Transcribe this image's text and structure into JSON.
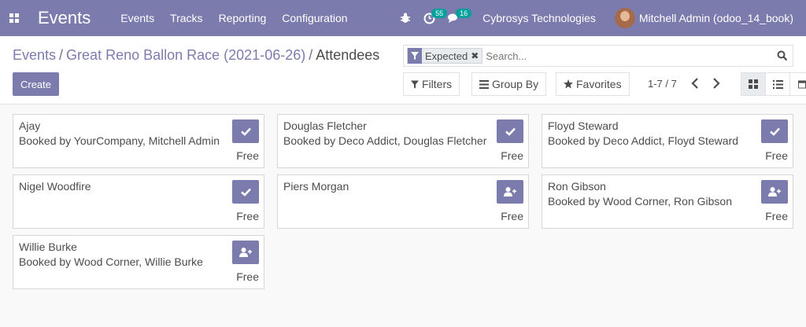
{
  "navbar": {
    "app_title": "Events",
    "menu": [
      "Events",
      "Tracks",
      "Reporting",
      "Configuration"
    ],
    "activity_count": "55",
    "message_count": "16",
    "company": "Cybrosys Technologies",
    "user": "Mitchell Admin (odoo_14_book)"
  },
  "breadcrumb": {
    "items": [
      "Events",
      "Great Reno Ballon Race (2021-06-26)"
    ],
    "separator": "/",
    "current": "Attendees"
  },
  "search": {
    "facet": "Expected",
    "placeholder": "Search..."
  },
  "toolbar": {
    "create_label": "Create",
    "filters_label": "Filters",
    "groupby_label": "Group By",
    "favorites_label": "Favorites"
  },
  "pager": {
    "value": "1-7 / 7"
  },
  "colors": {
    "brand": "#7c7bad",
    "badge": "#00a09d"
  },
  "cards": [
    {
      "name": "Ajay",
      "booked": "Booked by YourCompany, Mitchell Admin",
      "price": "Free",
      "action_icon": "check-icon"
    },
    {
      "name": "Douglas Fletcher",
      "booked": "Booked by Deco Addict, Douglas Fletcher",
      "price": "Free",
      "action_icon": "check-icon"
    },
    {
      "name": "Floyd Steward",
      "booked": "Booked by Deco Addict, Floyd Steward",
      "price": "Free",
      "action_icon": "check-icon"
    },
    {
      "name": "Nigel Woodfire",
      "booked": "",
      "price": "Free",
      "action_icon": "check-icon"
    },
    {
      "name": "Piers Morgan",
      "booked": "",
      "price": "Free",
      "action_icon": "user-plus-icon"
    },
    {
      "name": "Ron Gibson",
      "booked": "Booked by Wood Corner, Ron Gibson",
      "price": "Free",
      "action_icon": "user-plus-icon"
    },
    {
      "name": "Willie Burke",
      "booked": "Booked by Wood Corner, Willie Burke",
      "price": "Free",
      "action_icon": "user-plus-icon"
    }
  ]
}
